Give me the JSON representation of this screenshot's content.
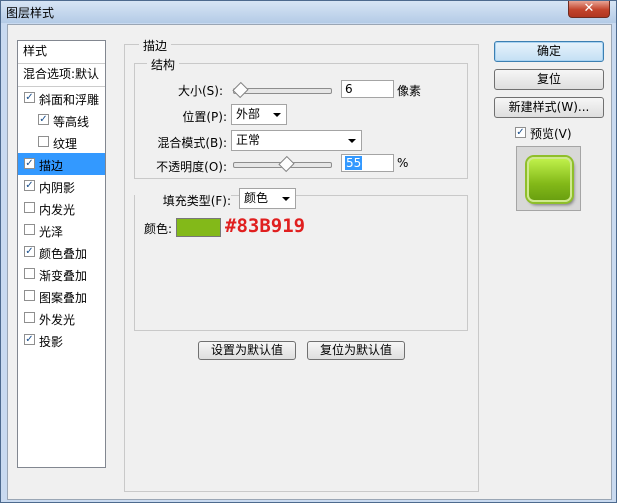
{
  "window": {
    "title": "图层样式",
    "close_glyph": "✕"
  },
  "left_panel": {
    "header": "样式",
    "blend_options": "混合选项:默认",
    "items": [
      {
        "label": "斜面和浮雕",
        "checked": true,
        "selected": false,
        "indent": false
      },
      {
        "label": "等高线",
        "checked": true,
        "selected": false,
        "indent": true
      },
      {
        "label": "纹理",
        "checked": false,
        "selected": false,
        "indent": true
      },
      {
        "label": "描边",
        "checked": true,
        "selected": true,
        "indent": false
      },
      {
        "label": "内阴影",
        "checked": true,
        "selected": false,
        "indent": false
      },
      {
        "label": "内发光",
        "checked": false,
        "selected": false,
        "indent": false
      },
      {
        "label": "光泽",
        "checked": false,
        "selected": false,
        "indent": false
      },
      {
        "label": "颜色叠加",
        "checked": true,
        "selected": false,
        "indent": false
      },
      {
        "label": "渐变叠加",
        "checked": false,
        "selected": false,
        "indent": false
      },
      {
        "label": "图案叠加",
        "checked": false,
        "selected": false,
        "indent": false
      },
      {
        "label": "外发光",
        "checked": false,
        "selected": false,
        "indent": false
      },
      {
        "label": "投影",
        "checked": true,
        "selected": false,
        "indent": false
      }
    ]
  },
  "stroke": {
    "group_title": "描边",
    "structure_title": "结构",
    "size_label": "大小(S):",
    "size_value": "6",
    "size_unit": "像素",
    "size_slider_fraction": 0.02,
    "position_label": "位置(P):",
    "position_value": "外部",
    "blend_mode_label": "混合模式(B):",
    "blend_mode_value": "正常",
    "opacity_label": "不透明度(O):",
    "opacity_value": "55",
    "opacity_unit": "%",
    "opacity_slider_fraction": 0.55,
    "fill_type_label": "填充类型(F):",
    "fill_type_value": "颜色",
    "color_label": "颜色:",
    "color_hex": "#83B919",
    "annotation": "#83B919"
  },
  "bottom_buttons": {
    "set_default": "设置为默认值",
    "reset_default": "复位为默认值"
  },
  "right_panel": {
    "ok": "确定",
    "reset": "复位",
    "new_style": "新建样式(W)...",
    "preview_label": "预览(V)",
    "preview_checked": true
  },
  "check_glyph": "✓"
}
